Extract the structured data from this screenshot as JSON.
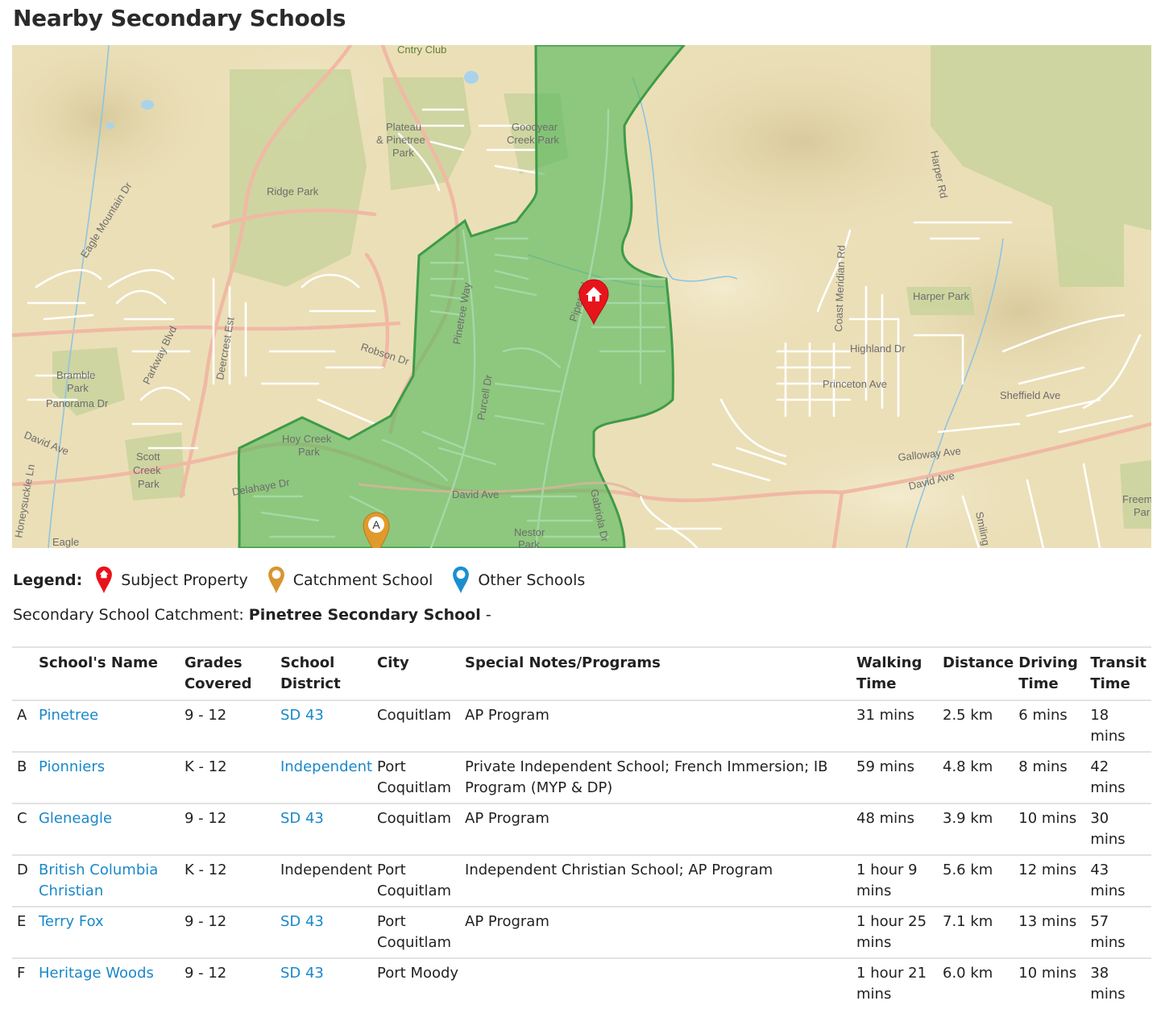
{
  "page_title": "Nearby Secondary Schools",
  "map": {
    "labels": {
      "cntry_club": "Cntry Club",
      "plateau_1": "Plateau",
      "plateau_2": "& Pinetree",
      "plateau_3": "Park",
      "goodyear_1": "Goodyear",
      "goodyear_2": "Creek Park",
      "ridge_park": "Ridge Park",
      "eagle_mountain_dr": "Eagle Mountain Dr",
      "harper_rd": "Harper Rd",
      "harper_park": "Harper Park",
      "coast_meridian_rd": "Coast Meridian Rd",
      "highland_dr": "Highland Dr",
      "princeton_ave": "Princeton Ave",
      "sheffield_ave": "Sheffield Ave",
      "galloway_ave": "Galloway Ave",
      "david_ave_east": "David Ave",
      "smiling": "Smiling",
      "freem_1": "Freem",
      "freem_2": "Par",
      "pinetree_way": "Pinetree Way",
      "piper_rd": "Piper Rd",
      "robson_dr": "Robson Dr",
      "purcell_dr": "Purcell Dr",
      "parkway_blvd": "Parkway Blvd",
      "deercrest_est": "Deercrest Est",
      "bramble_1": "Bramble",
      "bramble_2": "Park",
      "panorama_dr": "Panorama Dr",
      "david_ave_west": "David Ave",
      "honeysuckle_ln": "Honeysuckle Ln",
      "scott_1": "Scott",
      "scott_2": "Creek",
      "scott_3": "Park",
      "hoy_1": "Hoy Creek",
      "hoy_2": "Park",
      "delahaye_dr": "Delahaye Dr",
      "david_ave_mid": "David Ave",
      "gabriola_dr": "Gabriola Dr",
      "nestor_1": "Nestor",
      "nestor_2": "Park",
      "eagle_bottom": "Eagle"
    },
    "markers": [
      {
        "type": "subject",
        "icon": "house-icon",
        "color": "#e8141c"
      },
      {
        "type": "catchment",
        "letter": "A",
        "color": "#e09a2c"
      }
    ],
    "catchment_color": "#56b85a"
  },
  "legend": {
    "title": "Legend:",
    "items": [
      {
        "label": "Subject Property",
        "color": "#e8141c",
        "icon": "house-pin-icon"
      },
      {
        "label": "Catchment School",
        "color": "#d8952f",
        "icon": "catchment-pin-icon"
      },
      {
        "label": "Other Schools",
        "color": "#1a8fd0",
        "icon": "other-school-pin-icon"
      }
    ]
  },
  "catchment_line": {
    "label": "Secondary School Catchment:",
    "school": "Pinetree Secondary School",
    "suffix": "-"
  },
  "table": {
    "headers": {
      "name": "School's Name",
      "grades": "Grades Covered",
      "district": "School District",
      "city": "City",
      "notes": "Special Notes/Programs",
      "walking": "Walking Time",
      "distance": "Distance",
      "driving": "Driving Time",
      "transit": "Transit Time"
    },
    "rows": [
      {
        "letter": "A",
        "name": "Pinetree",
        "grades": "9 - 12",
        "district": "SD 43",
        "city": "Coquitlam",
        "notes": "AP Program",
        "walking": "31 mins",
        "distance": "2.5 km",
        "driving": "6 mins",
        "transit": "18 mins"
      },
      {
        "letter": "B",
        "name": "Pionniers",
        "grades": "K - 12",
        "district": "Independent",
        "city": "Port Coquitlam",
        "notes": "Private Independent School; French Immersion; IB Program (MYP & DP)",
        "walking": "59 mins",
        "distance": "4.8 km",
        "driving": "8 mins",
        "transit": "42 mins"
      },
      {
        "letter": "C",
        "name": "Gleneagle",
        "grades": "9 - 12",
        "district": "SD 43",
        "city": "Coquitlam",
        "notes": "AP Program",
        "walking": "48 mins",
        "distance": "3.9 km",
        "driving": "10 mins",
        "transit": "30 mins"
      },
      {
        "letter": "D",
        "name": "British Columbia Christian",
        "grades": "K - 12",
        "district": "Independent",
        "city": "Port Coquitlam",
        "notes": "Independent Christian School; AP Program",
        "walking": "1 hour 9 mins",
        "distance": "5.6 km",
        "driving": "12 mins",
        "transit": "43 mins"
      },
      {
        "letter": "E",
        "name": "Terry Fox",
        "grades": "9 - 12",
        "district": "SD 43",
        "city": "Port Coquitlam",
        "notes": "AP Program",
        "walking": "1 hour 25 mins",
        "distance": "7.1 km",
        "driving": "13 mins",
        "transit": "57 mins"
      },
      {
        "letter": "F",
        "name": "Heritage Woods",
        "grades": "9 - 12",
        "district": "SD 43",
        "city": "Port Moody",
        "notes": "",
        "walking": "1 hour 21 mins",
        "distance": "6.0 km",
        "driving": "10 mins",
        "transit": "38 mins"
      }
    ]
  }
}
